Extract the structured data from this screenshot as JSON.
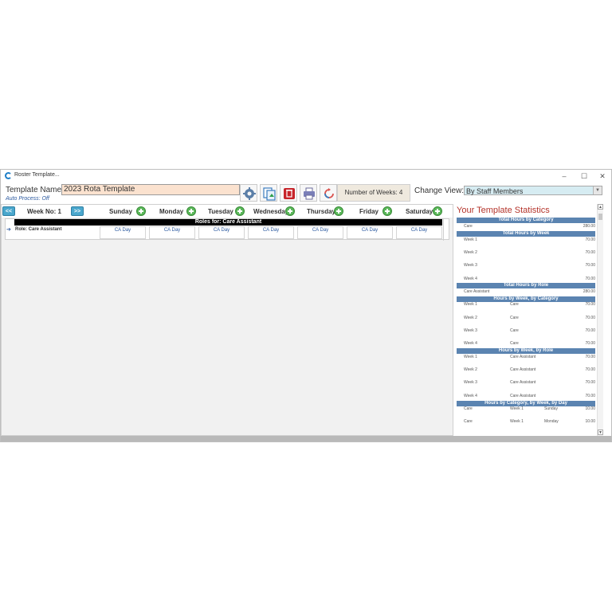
{
  "window": {
    "title": "Roster Template...",
    "min_glyph": "–",
    "max_glyph": "☐",
    "close_glyph": "✕"
  },
  "header": {
    "template_label": "Template Name:",
    "template_value": "2023 Rota Template",
    "auto_process": "Auto Process: Off",
    "toolbar_icons": [
      "gear-icon",
      "copy-template-icon",
      "delete-icon",
      "print-icon",
      "refresh-icon"
    ],
    "weeks_text": "Number of Weeks: 4",
    "change_view_label": "Change View:",
    "change_view_value": "By Staff Members"
  },
  "grid": {
    "prev_label": "<<",
    "next_label": ">>",
    "week_label": "Week No: 1",
    "days": [
      "Sunday",
      "Monday",
      "Tuesday",
      "Wednesday",
      "Thursday",
      "Friday",
      "Saturday"
    ],
    "roles_bar": "Roles for: Care Assistant",
    "row_marker": "➔",
    "role_label": "Role: Care Assistant",
    "cells": [
      "CA Day",
      "CA Day",
      "CA Day",
      "CA Day",
      "CA Day",
      "CA Day",
      "CA Day"
    ]
  },
  "stats": {
    "title": "Your Template Statistics",
    "h1": "Total Hours by Category",
    "cat_care": "Care",
    "cat_care_value": "280.00",
    "h2": "Total Hours by Week",
    "weeks": [
      {
        "week": "Week 1",
        "value": "70.00"
      },
      {
        "week": "Week 2",
        "value": "70.00"
      },
      {
        "week": "Week 3",
        "value": "70.00"
      },
      {
        "week": "Week 4",
        "value": "70.00"
      }
    ],
    "h3": "Total Hours by Role",
    "role_ca": "Care Assistant",
    "role_ca_value": "280.00",
    "h4": "Hours by Week, by Category",
    "week_cat": [
      {
        "week": "Week 1",
        "cat": "Care",
        "value": "70.00"
      },
      {
        "week": "Week 2",
        "cat": "Care",
        "value": "70.00"
      },
      {
        "week": "Week 3",
        "cat": "Care",
        "value": "70.00"
      },
      {
        "week": "Week 4",
        "cat": "Care",
        "value": "70.00"
      }
    ],
    "h5": "Hours by Week, by Role",
    "week_role": [
      {
        "week": "Week 1",
        "role": "Care Assistant",
        "value": "70.00"
      },
      {
        "week": "Week 2",
        "role": "Care Assistant",
        "value": "70.00"
      },
      {
        "week": "Week 3",
        "role": "Care Assistant",
        "value": "70.00"
      },
      {
        "week": "Week 4",
        "role": "Care Assistant",
        "value": "70.00"
      }
    ],
    "h6": "Hours by Category, by Week, by Day",
    "cat_week_day": [
      {
        "cat": "Care",
        "week": "Week 1",
        "day": "Sunday",
        "value": "10.00"
      },
      {
        "cat": "Care",
        "week": "Week 1",
        "day": "Monday",
        "value": "10.00"
      }
    ]
  },
  "colors": {
    "accent_blue": "#5b84b1",
    "stats_title": "#b4342b",
    "template_input_bg": "#fbe2cf",
    "select_bg": "#d6ecf2",
    "nav_button": "#4aa7cd"
  }
}
